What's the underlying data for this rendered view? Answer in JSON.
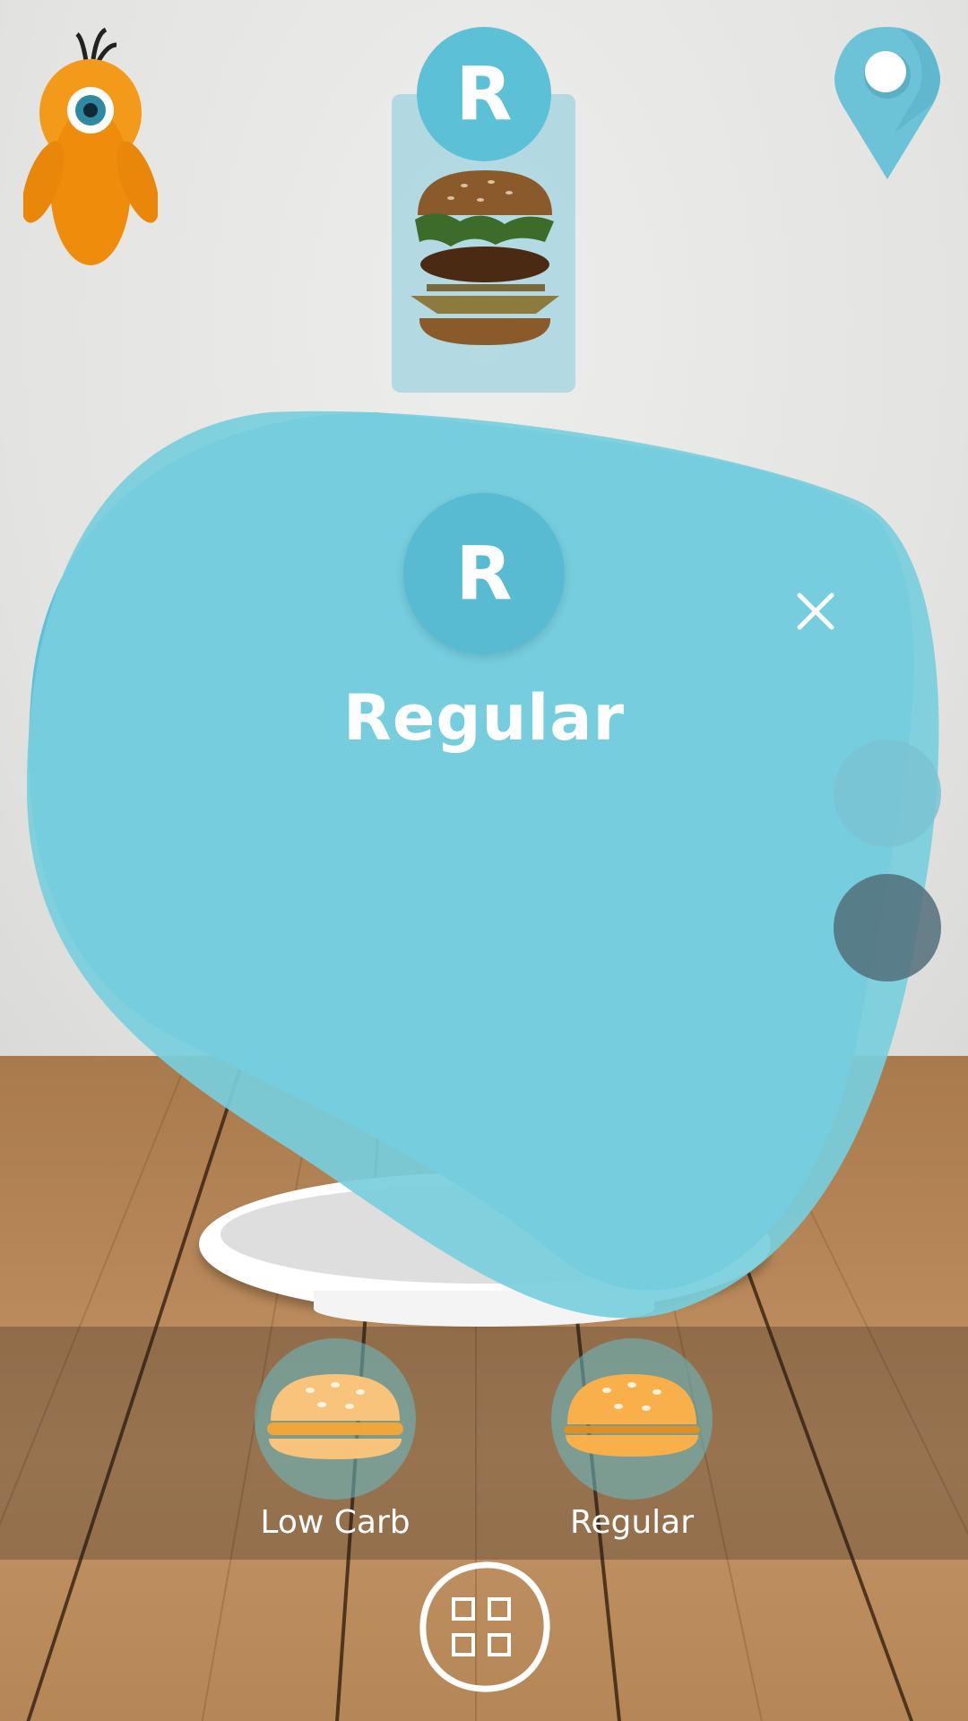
{
  "header": {
    "selected_badge_letter": "R",
    "mascot_icon": "orange-one-eyed-mascot-icon",
    "location_icon": "map-pin-icon",
    "selected_item_icon": "burger-icon"
  },
  "popup": {
    "badge_letter": "R",
    "title": "Regular",
    "close_icon": "close-icon",
    "background_color": "#6ecadb"
  },
  "options": [
    {
      "label": "Low Carb",
      "icon": "bun-icon"
    },
    {
      "label": "Regular",
      "icon": "bun-icon"
    }
  ],
  "footer": {
    "menu_icon": "grid-icon"
  }
}
